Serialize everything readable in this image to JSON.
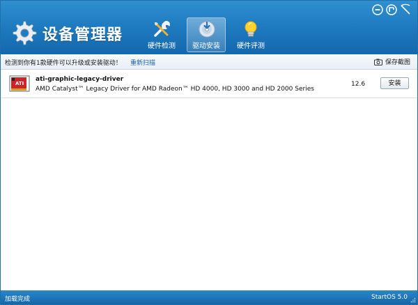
{
  "app": {
    "title": "设备管理器"
  },
  "tabs": [
    {
      "label": "硬件检测",
      "icon": "tools-icon"
    },
    {
      "label": "驱动安装",
      "icon": "driver-disc-icon"
    },
    {
      "label": "硬件评测",
      "icon": "lightbulb-icon"
    }
  ],
  "infobar": {
    "message": "检测到你有1款硬件可以升级或安装驱动！",
    "rescan_label": "重新扫描",
    "save_label": "保存截图"
  },
  "drivers": [
    {
      "name": "ati-graphic-legacy-driver",
      "description": "AMD Catalyst™ Legacy Driver for AMD Radeon™ HD 4000, HD 3000 and HD 2000 Series",
      "version": "12.6",
      "action_label": "安装"
    }
  ],
  "status": {
    "left": "加载完成",
    "right": "StartOS 5.0"
  },
  "colors": {
    "header": "#1f7cc0",
    "accent_link": "#1a64b7",
    "statusbar": "#1566a8"
  }
}
